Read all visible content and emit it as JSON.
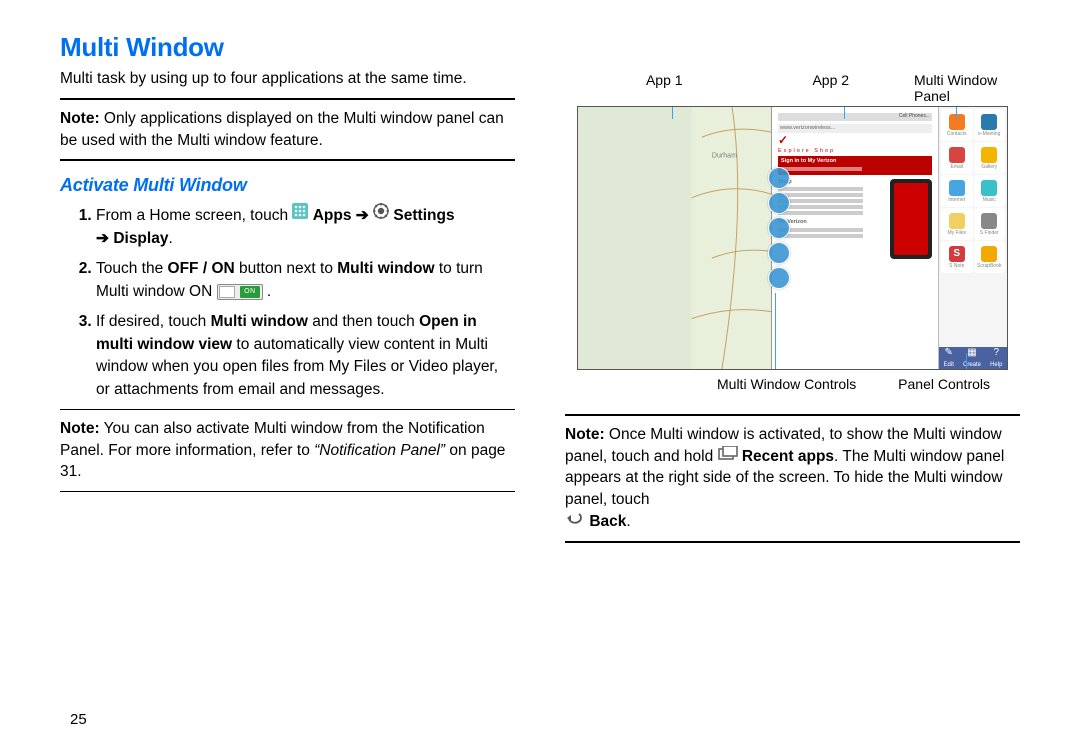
{
  "heading": "Multi Window",
  "intro": "Multi task by using up to four applications at the same time.",
  "note1_prefix": "Note:",
  "note1_body": " Only applications displayed on the Multi window panel can be used with the Multi window feature.",
  "subheading": "Activate Multi Window",
  "step1_a": "From a Home screen, touch ",
  "step1_apps": "Apps",
  "step1_settings": "Settings",
  "step1_display": "Display",
  "step2_a": "Touch the ",
  "step2_offon": "OFF / ON",
  "step2_b": " button next to ",
  "step2_mw": "Multi window",
  "step2_c": " to turn Multi window ON ",
  "toggle_on": "ON",
  "step3_a": "If desired, touch ",
  "step3_b": " and then touch ",
  "step3_open": "Open in multi window view",
  "step3_c": " to automatically view content in Multi window when you open files from My Files or Video player, or attachments from email and messages.",
  "note2_prefix": "Note:",
  "note2_body": " You can also activate Multi window from the Notification Panel. For more information, refer to ",
  "note2_ref": "“Notification Panel”",
  "note2_page": " on page 31.",
  "pagenum": "25",
  "fig": {
    "app1": "App 1",
    "app2": "App 2",
    "mw_panel": "Multi Window Panel",
    "mw_controls": "Multi Window Controls",
    "panel_controls": "Panel Controls",
    "icons": {
      "contacts": "Contacts",
      "emeeting": "e-Meeting",
      "email": "Email",
      "gallery": "Gallery",
      "internet": "Internet",
      "music": "Music",
      "myfiles": "My Files",
      "sfinder": "S Finder",
      "snote": "S Note",
      "scrapbook": "ScrapBook"
    },
    "panelctrl": {
      "edit": "Edit",
      "create": "Create",
      "help": "Help"
    },
    "web": {
      "addr": "www.verizonwireless...",
      "tab": "Cell Phones...",
      "signin": "Sign in to My Verizon",
      "nav": "Explore   Shop",
      "shop_hdr": "Shop",
      "myv": "My Verizon"
    }
  },
  "note3_prefix": "Note:",
  "note3_a": " Once Multi window is activated, to show the Multi window panel, touch and hold ",
  "note3_recent": "Recent apps",
  "note3_b": ". The Multi window panel appears at the right side of the screen. To hide the Multi window panel, touch ",
  "note3_back": "Back",
  "period": "."
}
